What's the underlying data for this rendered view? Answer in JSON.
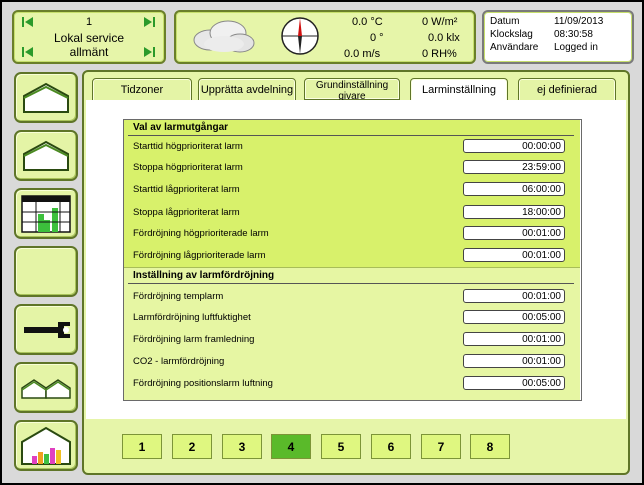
{
  "location": {
    "number": "1",
    "name": "Lokal service",
    "category": "allmänt"
  },
  "weather": {
    "temperature": "0.0 °C",
    "radiation": "0 W/m²",
    "direction": "0 °",
    "light": "0.0 klx",
    "wind_speed": "0.0 m/s",
    "humidity": "0 RH%"
  },
  "info": {
    "date_label": "Datum",
    "date_value": "11/09/2013",
    "time_label": "Klockslag",
    "time_value": "08:30:58",
    "user_label": "Användare",
    "user_value": "Logged in"
  },
  "tabs": [
    {
      "label": "Tidzoner",
      "active": false
    },
    {
      "label": "Upprätta avdelning",
      "active": false
    },
    {
      "label_line1": "Grundinställning",
      "label_line2": "givare",
      "active": false
    },
    {
      "label": "Larminställning",
      "active": true
    },
    {
      "label": "ej definierad",
      "active": false
    }
  ],
  "alarm_outputs": {
    "heading": "Val av larmutgångar",
    "rows": [
      {
        "label": "Starttid högprioriterat larm",
        "value": "00:00:00"
      },
      {
        "label": "Stoppa högprioriterat larm",
        "value": "23:59:00"
      },
      {
        "label": "Starttid lågprioriterat larm",
        "value": "06:00:00"
      },
      {
        "label": "Stoppa lågprioriterat larm",
        "value": "18:00:00"
      },
      {
        "label": "Fördröjning högprioriterade larm",
        "value": "00:01:00"
      },
      {
        "label": "Fördröjning lågprioriterade larm",
        "value": "00:01:00"
      }
    ]
  },
  "alarm_delay": {
    "heading": "Inställning av larmfördröjning",
    "rows": [
      {
        "label": "Fördröjning templarm",
        "value": "00:01:00"
      },
      {
        "label": "Larmfördröjning luftfuktighet",
        "value": "00:05:00"
      },
      {
        "label": "Fördröjning larm framledning",
        "value": "00:01:00"
      },
      {
        "label": "CO2 - larmfördröjning",
        "value": "00:01:00"
      },
      {
        "label": "Fördröjning positionslarm luftning",
        "value": "00:05:00"
      }
    ]
  },
  "pages": [
    "1",
    "2",
    "3",
    "4",
    "5",
    "6",
    "7",
    "8"
  ],
  "active_page": "4",
  "colors": {
    "panel_green": "#e6f5a9",
    "section_green": "#d8f16b",
    "active_page": "#5aba2a"
  },
  "icons": {
    "nav": [
      "greenhouse-icon",
      "greenhouse-icon",
      "chart-grid-icon",
      "blank-icon",
      "wrench-icon",
      "twin-greenhouse-icon",
      "greenhouse-bar-chart-icon"
    ]
  }
}
